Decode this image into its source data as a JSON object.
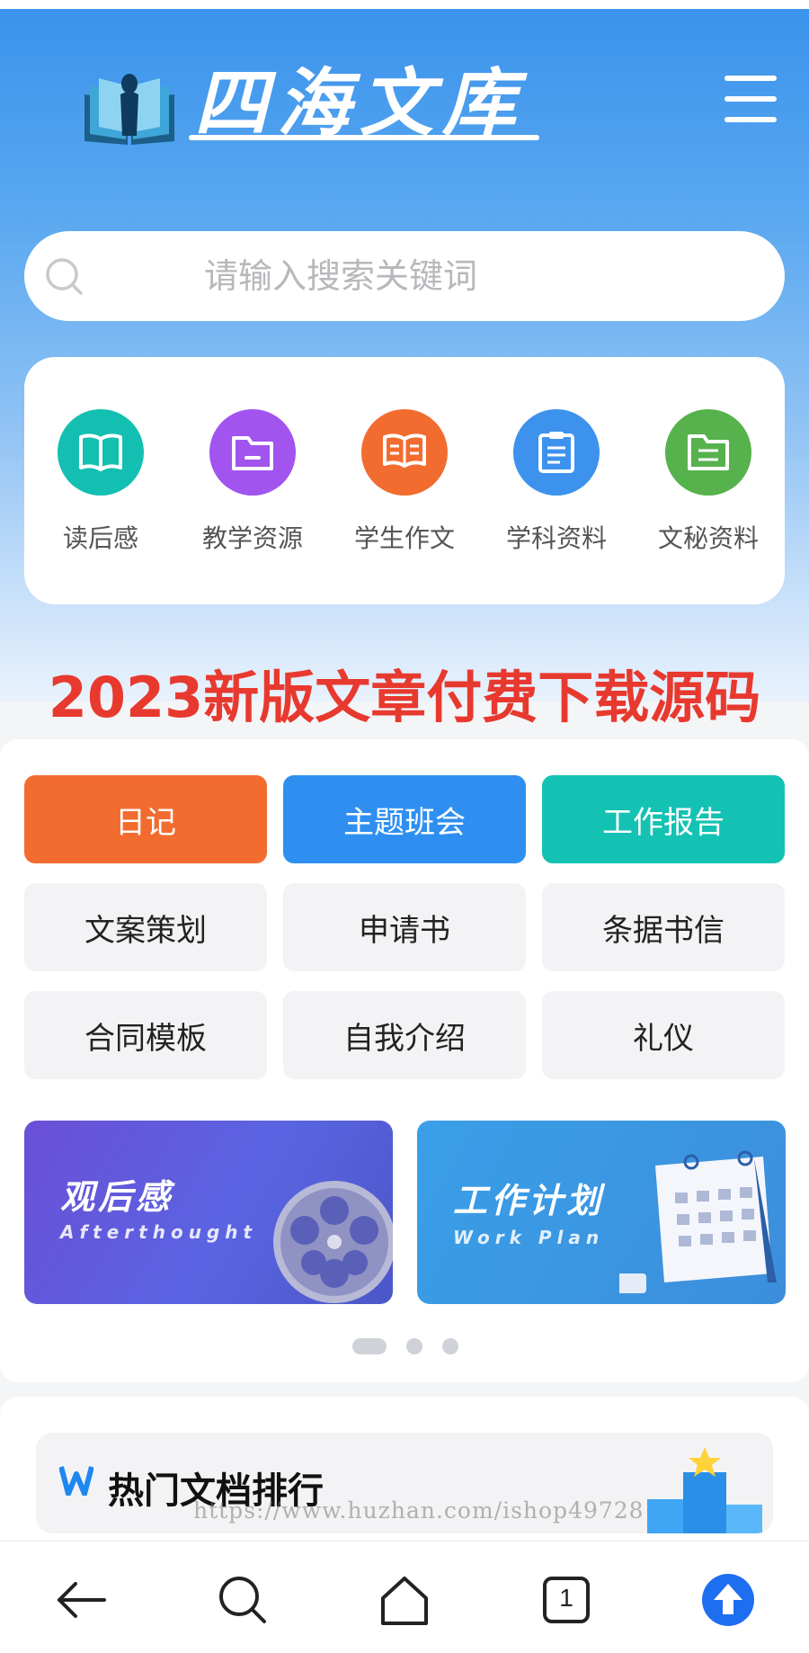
{
  "header": {
    "logo_text": "四海文库",
    "menu_icon": "hamburger-menu-icon"
  },
  "search": {
    "placeholder": "请输入搜索关键词"
  },
  "categories": [
    {
      "label": "读后感",
      "color": "#13bfb0",
      "icon": "open-book-icon"
    },
    {
      "label": "教学资源",
      "color": "#a154ee",
      "icon": "folder-icon"
    },
    {
      "label": "学生作文",
      "color": "#f26c2f",
      "icon": "book-icon"
    },
    {
      "label": "学科资料",
      "color": "#3d92ee",
      "icon": "clipboard-icon"
    },
    {
      "label": "文秘资料",
      "color": "#56b24c",
      "icon": "file-folder-icon"
    }
  ],
  "promo_banner": "2023新版文章付费下载源码",
  "tags": [
    {
      "label": "日记",
      "color": "#f26c2f"
    },
    {
      "label": "主题班会",
      "color": "#2f8ff0"
    },
    {
      "label": "工作报告",
      "color": "#13c2b2"
    },
    {
      "label": "文案策划"
    },
    {
      "label": "申请书"
    },
    {
      "label": "条据书信"
    },
    {
      "label": "合同模板"
    },
    {
      "label": "自我介绍"
    },
    {
      "label": "礼仪"
    }
  ],
  "promos": [
    {
      "title": "观后感",
      "subtitle": "Afterthought"
    },
    {
      "title": "工作计划",
      "subtitle": "Work Plan"
    }
  ],
  "carousel": {
    "total": 3,
    "active": 1
  },
  "hot": {
    "title": "热门文档排行"
  },
  "watermark": "https://www.huzhan.com/ishop49728",
  "bottom_nav": {
    "tab_count": "1"
  }
}
